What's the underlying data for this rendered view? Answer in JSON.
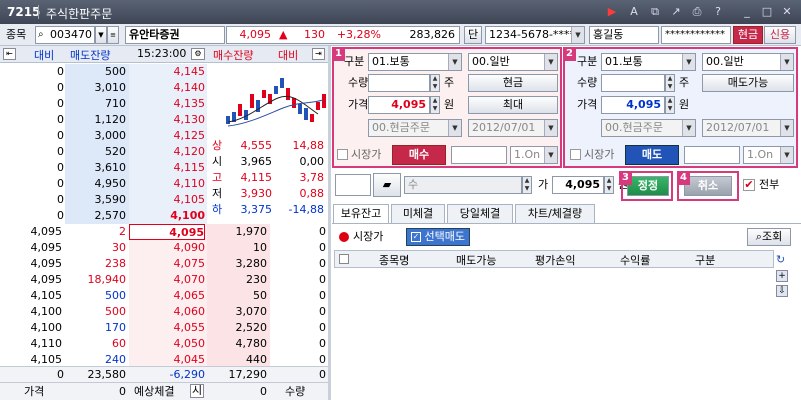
{
  "window": {
    "code": "7215",
    "title": "주식한판주문"
  },
  "toolbar": {
    "stock_label": "종목",
    "stock_code": "003470",
    "stock_name": "유안타증권",
    "price": "4,095",
    "change_arrow": "▲",
    "change": "130",
    "change_pct": "+3,28%",
    "volume": "283,826",
    "account_label": "단",
    "account": "1234-5678-*****",
    "user": "홍길동",
    "password": "************",
    "cash_label": "현금",
    "credit_label": "신용"
  },
  "orderbook": {
    "headers": {
      "diff": "대비",
      "sell_qty": "매도잔량",
      "time": "15:23:00",
      "buy_qty": "매수잔량",
      "diff2": "대비"
    },
    "asks": [
      {
        "diff": "0",
        "qty": "500",
        "price": "4,145"
      },
      {
        "diff": "0",
        "qty": "3,010",
        "price": "4,140"
      },
      {
        "diff": "0",
        "qty": "710",
        "price": "4,135"
      },
      {
        "diff": "0",
        "qty": "1,120",
        "price": "4,130"
      },
      {
        "diff": "0",
        "qty": "3,000",
        "price": "4,125"
      },
      {
        "diff": "0",
        "qty": "520",
        "price": "4,120"
      },
      {
        "diff": "0",
        "qty": "3,610",
        "price": "4,115"
      },
      {
        "diff": "0",
        "qty": "4,950",
        "price": "4,110"
      },
      {
        "diff": "0",
        "qty": "3,590",
        "price": "4,105"
      },
      {
        "diff": "0",
        "qty": "2,570",
        "price": "4,100"
      }
    ],
    "bids": [
      {
        "price": "4,095",
        "qty": "1,970",
        "diff": "0"
      },
      {
        "price": "4,090",
        "qty": "10",
        "diff": "0"
      },
      {
        "price": "4,075",
        "qty": "3,280",
        "diff": "0"
      },
      {
        "price": "4,070",
        "qty": "230",
        "diff": "0"
      },
      {
        "price": "4,065",
        "qty": "50",
        "diff": "0"
      },
      {
        "price": "4,060",
        "qty": "3,070",
        "diff": "0"
      },
      {
        "price": "4,055",
        "qty": "2,520",
        "diff": "0"
      },
      {
        "price": "4,050",
        "qty": "4,780",
        "diff": "0"
      },
      {
        "price": "4,045",
        "qty": "440",
        "diff": "0"
      },
      {
        "price": "4,040",
        "qty": "940",
        "diff": "0"
      }
    ],
    "trades": [
      {
        "price": "4,095",
        "qty": "2"
      },
      {
        "price": "4,095",
        "qty": "30"
      },
      {
        "price": "4,095",
        "qty": "238"
      },
      {
        "price": "4,095",
        "qty": "18,940"
      },
      {
        "price": "4,105",
        "qty": "500"
      },
      {
        "price": "4,100",
        "qty": "500"
      },
      {
        "price": "4,100",
        "qty": "170"
      },
      {
        "price": "4,110",
        "qty": "60"
      },
      {
        "price": "4,105",
        "qty": "240"
      },
      {
        "price": "4,105",
        "qty": "10"
      }
    ],
    "info": [
      {
        "label": "상",
        "value": "4,555",
        "pct": "14,88"
      },
      {
        "label": "시",
        "value": "3,965",
        "pct": "0,00"
      },
      {
        "label": "고",
        "value": "4,115",
        "pct": "3,78"
      },
      {
        "label": "저",
        "value": "3,930",
        "pct": "0,88"
      },
      {
        "label": "하",
        "value": "3,375",
        "pct": "-14,88"
      }
    ],
    "totals": {
      "diff": "0",
      "sell_total": "23,580",
      "diff_total": "-6,290",
      "buy_total": "17,290",
      "diff_right": "0"
    },
    "footer": {
      "price_label": "가격",
      "price_value": "0",
      "expect_label": "예상체결",
      "si": "시",
      "qty_value": "0",
      "qty_label": "수량"
    }
  },
  "buy_panel": {
    "badge": "1",
    "type_label": "구분",
    "type_value": "01.보통",
    "cond_value": "00.일반",
    "qty_label": "수량",
    "qty_unit": "주",
    "cash_btn": "현금",
    "price_label": "가격",
    "price_value": "4,095",
    "price_unit": "원",
    "max_btn": "최대",
    "order_type": "00.현금주문",
    "date": "2012/07/01",
    "market_label": "시장가",
    "action": "매수",
    "on": "1.On"
  },
  "sell_panel": {
    "badge": "2",
    "type_label": "구분",
    "type_value": "01.보통",
    "cond_value": "00.일반",
    "qty_label": "수량",
    "qty_unit": "주",
    "avail_btn": "매도가능",
    "price_label": "가격",
    "price_value": "4,095",
    "price_unit": "원",
    "order_type": "00.현금주문",
    "date": "2012/07/01",
    "market_label": "시장가",
    "action": "매도",
    "on": "1.On"
  },
  "modify": {
    "qty_label": "수",
    "price_label": "가",
    "price_value": "4,095",
    "price_unit": "원",
    "badge3": "3",
    "modify_btn": "정정",
    "badge4": "4",
    "cancel_btn": "취소",
    "all_label": "전부"
  },
  "tabs": [
    "보유잔고",
    "미체결",
    "당일체결",
    "차트/체결량"
  ],
  "holdings": {
    "market_label": "시장가",
    "select_sell": "선택매도",
    "query_btn": "조회",
    "columns": [
      "종목명",
      "매도가능",
      "평가손익",
      "수익률",
      "구분"
    ]
  },
  "colors": {
    "accent": "#d63a7d",
    "sell_bg": "#dde8f8",
    "buy_bg": "#fbe3e6",
    "red": "#e0001b",
    "blue": "#0033cc"
  }
}
